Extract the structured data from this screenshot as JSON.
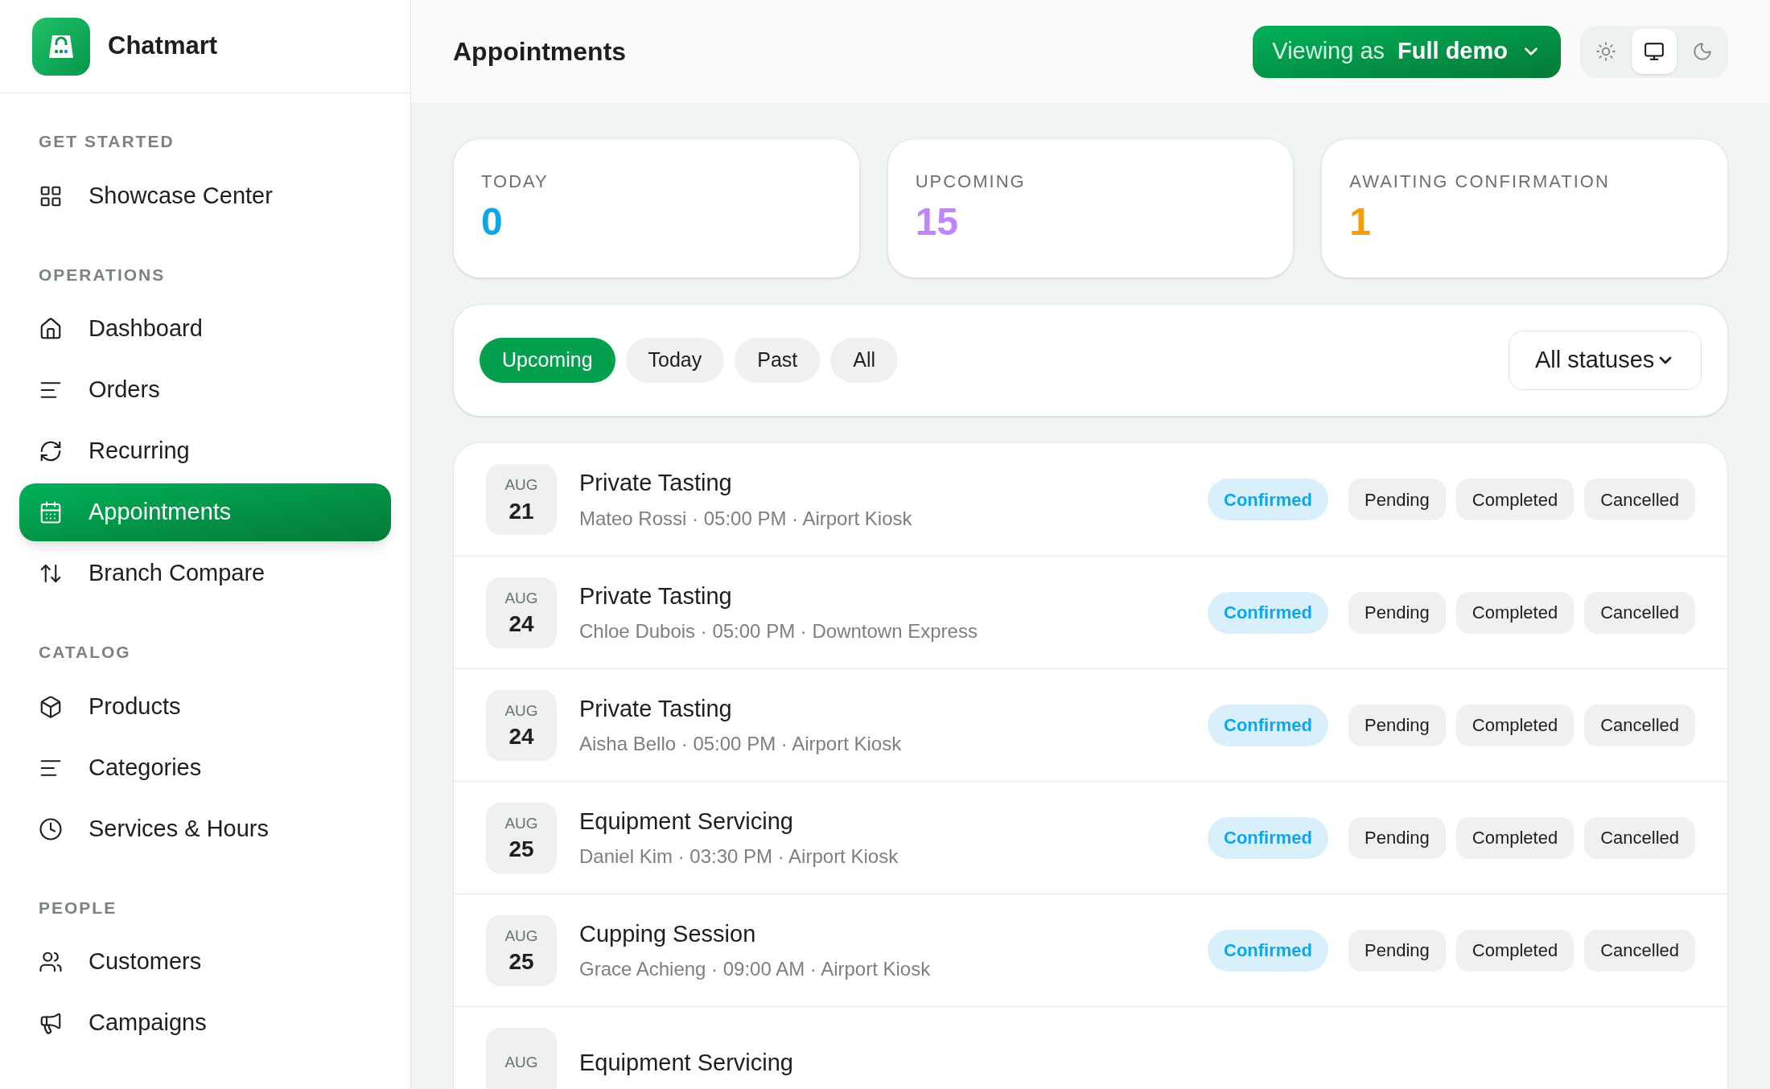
{
  "brand": {
    "name": "Chatmart"
  },
  "sidebar": {
    "sections": [
      {
        "title": "GET STARTED",
        "items": [
          {
            "label": "Showcase Center",
            "selected": false
          }
        ]
      },
      {
        "title": "OPERATIONS",
        "items": [
          {
            "label": "Dashboard",
            "selected": false
          },
          {
            "label": "Orders",
            "selected": false
          },
          {
            "label": "Recurring",
            "selected": false
          },
          {
            "label": "Appointments",
            "selected": true
          },
          {
            "label": "Branch Compare",
            "selected": false
          }
        ]
      },
      {
        "title": "CATALOG",
        "items": [
          {
            "label": "Products",
            "selected": false
          },
          {
            "label": "Categories",
            "selected": false
          },
          {
            "label": "Services & Hours",
            "selected": false
          }
        ]
      },
      {
        "title": "PEOPLE",
        "items": [
          {
            "label": "Customers",
            "selected": false
          },
          {
            "label": "Campaigns",
            "selected": false
          }
        ]
      }
    ]
  },
  "header": {
    "title": "Appointments",
    "viewing_label": "Viewing as",
    "viewing_value": "Full demo",
    "theme_options": [
      {
        "kind": "light",
        "selected": false
      },
      {
        "kind": "system",
        "selected": true
      },
      {
        "kind": "dark",
        "selected": false
      }
    ]
  },
  "stats": [
    {
      "label": "TODAY",
      "value": "0",
      "color": "#0ea5e9"
    },
    {
      "label": "UPCOMING",
      "value": "15",
      "color": "#c084fc"
    },
    {
      "label": "AWAITING CONFIRMATION",
      "value": "1",
      "color": "#f59e0b"
    }
  ],
  "filters": {
    "tabs": [
      {
        "label": "Upcoming",
        "selected": true
      },
      {
        "label": "Today",
        "selected": false
      },
      {
        "label": "Past",
        "selected": false
      },
      {
        "label": "All",
        "selected": false
      }
    ],
    "status_select": "All statuses"
  },
  "appointments": [
    {
      "month": "AUG",
      "day": "21",
      "title": "Private Tasting",
      "details": "Mateo Rossi · 05:00 PM · Airport Kiosk",
      "statuses": [
        {
          "label": "Confirmed",
          "selected": true
        },
        {
          "label": "Pending",
          "selected": false
        },
        {
          "label": "Completed",
          "selected": false
        },
        {
          "label": "Cancelled",
          "selected": false
        }
      ]
    },
    {
      "month": "AUG",
      "day": "24",
      "title": "Private Tasting",
      "details": "Chloe Dubois · 05:00 PM · Downtown Express",
      "statuses": [
        {
          "label": "Confirmed",
          "selected": true
        },
        {
          "label": "Pending",
          "selected": false
        },
        {
          "label": "Completed",
          "selected": false
        },
        {
          "label": "Cancelled",
          "selected": false
        }
      ]
    },
    {
      "month": "AUG",
      "day": "24",
      "title": "Private Tasting",
      "details": "Aisha Bello · 05:00 PM · Airport Kiosk",
      "statuses": [
        {
          "label": "Confirmed",
          "selected": true
        },
        {
          "label": "Pending",
          "selected": false
        },
        {
          "label": "Completed",
          "selected": false
        },
        {
          "label": "Cancelled",
          "selected": false
        }
      ]
    },
    {
      "month": "AUG",
      "day": "25",
      "title": "Equipment Servicing",
      "details": "Daniel Kim · 03:30 PM · Airport Kiosk",
      "statuses": [
        {
          "label": "Confirmed",
          "selected": true
        },
        {
          "label": "Pending",
          "selected": false
        },
        {
          "label": "Completed",
          "selected": false
        },
        {
          "label": "Cancelled",
          "selected": false
        }
      ]
    },
    {
      "month": "AUG",
      "day": "25",
      "title": "Cupping Session",
      "details": "Grace Achieng · 09:00 AM · Airport Kiosk",
      "statuses": [
        {
          "label": "Confirmed",
          "selected": true
        },
        {
          "label": "Pending",
          "selected": false
        },
        {
          "label": "Completed",
          "selected": false
        },
        {
          "label": "Cancelled",
          "selected": false
        }
      ]
    },
    {
      "month": "AUG",
      "title": "Equipment Servicing"
    }
  ]
}
